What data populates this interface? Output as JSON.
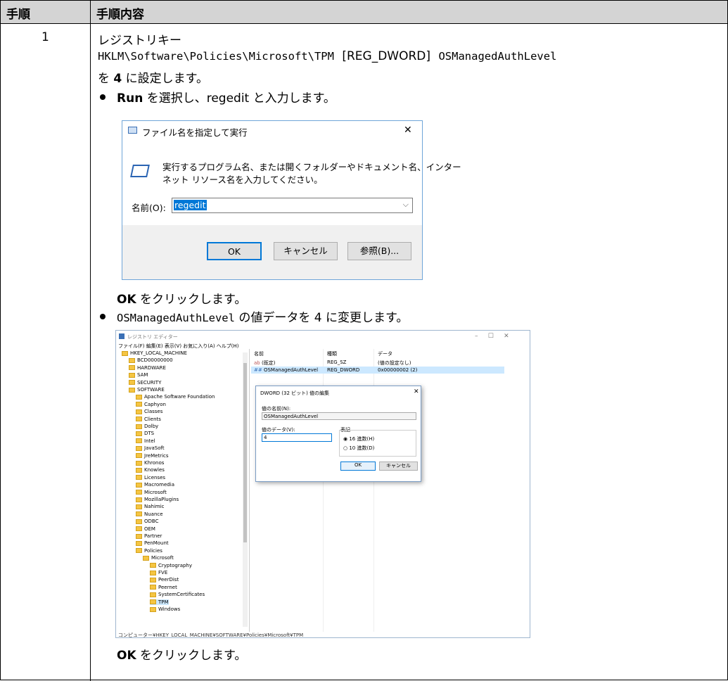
{
  "table": {
    "header_step": "手順",
    "header_content": "手順内容",
    "step_number": "1"
  },
  "content": {
    "line1": "レジストリキー",
    "registry_path": "HKLM\\Software\\Policies\\Microsoft\\TPM",
    "reg_type": "[REG_DWORD]",
    "reg_value": "OSManagedAuthLevel",
    "line3_prefix": "を",
    "line3_bold": "4",
    "line3_suffix": "に設定します。",
    "bullet1_bold": "Run",
    "bullet1_text": "を選択し、regedit と入力します。",
    "ok_click1_bold": "OK",
    "ok_click1_text": "をクリックします。",
    "bullet2_mono": "OSManagedAuthLevel",
    "bullet2_text": "の値データを 4 に変更します。",
    "ok_click2_bold": "OK",
    "ok_click2_text": "をクリックします。"
  },
  "run_dialog": {
    "title": "ファイル名を指定して実行",
    "description_1": "実行するプログラム名、または開くフォルダーやドキュメント名、インター",
    "description_2": "ネット リソース名を入力してください。",
    "name_label": "名前(O):",
    "name_value": "regedit",
    "ok": "OK",
    "cancel": "キャンセル",
    "browse": "参照(B)..."
  },
  "regedit": {
    "title": "レジストリ エディター",
    "menu": "ファイル(F)  編集(E)  表示(V)  お気に入り(A)  ヘルプ(H)",
    "tree": [
      "HKEY_LOCAL_MACHINE",
      "BCD00000000",
      "HARDWARE",
      "SAM",
      "SECURITY",
      "SOFTWARE",
      "Apache Software Foundation",
      "Caphyon",
      "Classes",
      "Clients",
      "Dolby",
      "DTS",
      "Intel",
      "JavaSoft",
      "JreMetrics",
      "Khronos",
      "Knowles",
      "Licenses",
      "Macromedia",
      "Microsoft",
      "MozillaPlugins",
      "Nahimic",
      "Nuance",
      "ODBC",
      "OEM",
      "Partner",
      "PenMount",
      "Policies",
      "Microsoft",
      "Cryptography",
      "FVE",
      "PeerDist",
      "Peernet",
      "SystemCertificates",
      "TPM",
      "Windows"
    ],
    "col_name": "名前",
    "col_type": "種類",
    "col_data": "データ",
    "r1_name": "(既定)",
    "r1_type": "REG_SZ",
    "r1_data": "(値の設定なし)",
    "r2_name": "OSManagedAuthLevel",
    "r2_type": "REG_DWORD",
    "r2_data": "0x00000002 (2)",
    "status": "コンピューター¥HKEY_LOCAL_MACHINE¥SOFTWARE¥Policies¥Microsoft¥TPM",
    "dialog": {
      "title": "DWORD (32 ビット) 値の編集",
      "value_name_label": "値の名前(N):",
      "value_name": "OSManagedAuthLevel",
      "value_data_label": "値のデータ(V):",
      "value_data": "4",
      "base_label": "表記",
      "hex": "16 進数(H)",
      "dec": "10 進数(D)",
      "ok": "OK",
      "cancel": "キャンセル"
    }
  }
}
